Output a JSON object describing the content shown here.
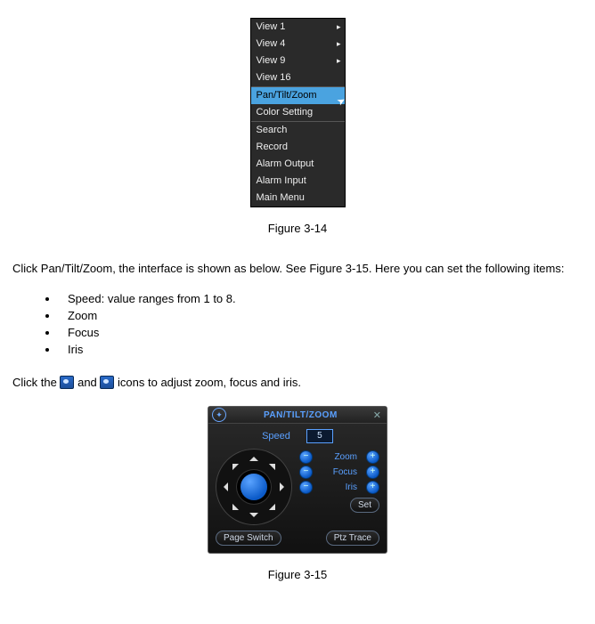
{
  "context_menu": {
    "groups": [
      {
        "items": [
          {
            "label": "View 1",
            "submenu": true
          },
          {
            "label": "View 4",
            "submenu": true
          },
          {
            "label": "View 9",
            "submenu": true
          },
          {
            "label": "View 16",
            "submenu": false
          }
        ]
      },
      {
        "items": [
          {
            "label": "Pan/Tilt/Zoom",
            "highlighted": true
          },
          {
            "label": "Color Setting"
          }
        ]
      },
      {
        "items": [
          {
            "label": "Search"
          },
          {
            "label": "Record"
          },
          {
            "label": "Alarm Output"
          },
          {
            "label": "Alarm Input"
          },
          {
            "label": "Main Menu"
          }
        ]
      }
    ]
  },
  "caption1": "Figure 3-14",
  "para1": "Click Pan/Tilt/Zoom, the interface is shown as below.  See Figure 3-15.  Here you can set the following items:",
  "bullet_items": [
    "Speed: value ranges from 1 to 8.",
    "Zoom",
    "Focus",
    "Iris"
  ],
  "para2_pre": "Click the ",
  "para2_mid": " and ",
  "para2_post": " icons to adjust zoom, focus and iris.",
  "ptz": {
    "title": "PAN/TILT/ZOOM",
    "speed_label": "Speed",
    "speed_value": "5",
    "rows": [
      {
        "label": "Zoom"
      },
      {
        "label": "Focus"
      },
      {
        "label": "Iris"
      }
    ],
    "set_btn": "Set",
    "page_switch": "Page Switch",
    "ptz_trace": "Ptz Trace"
  },
  "caption2": "Figure 3-15"
}
